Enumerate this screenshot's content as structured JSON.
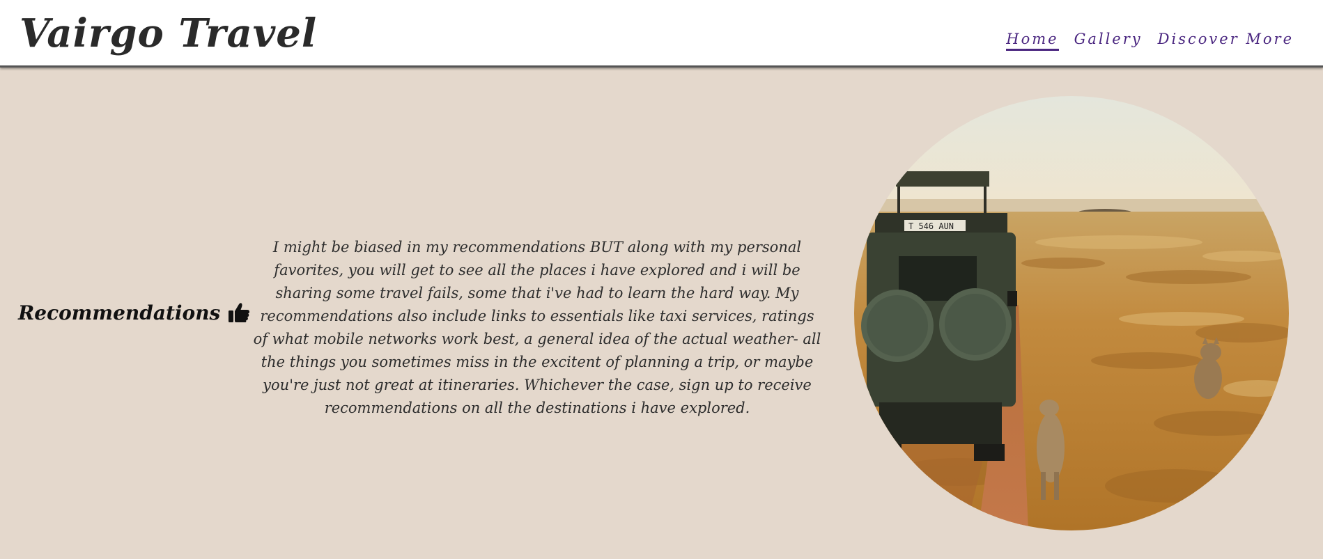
{
  "header": {
    "brand": "Vairgo Travel",
    "nav": [
      {
        "label": "Home",
        "active": true
      },
      {
        "label": "Gallery",
        "active": false
      },
      {
        "label": "Discover More",
        "active": false
      }
    ]
  },
  "main": {
    "section_title": "Recommendations",
    "section_icon": "thumbs-up-icon",
    "blurb_part1": "I might be biased in my recommendations BUT along with my personal favorites, you will get to see all the places i have explored and i will be sharing some travel fails, some that i've had to learn the hard way. My recommendations also include links to essentials like taxi services, ratings of what mobile networks work best, a general idea of the ",
    "blurb_emphasis": "actual",
    "blurb_part2": " weather- all the things you sometimes miss in the excitent of planning a trip, or maybe you're just not great at itineraries. Whichever the case, sign up to receive recommendations on all the destinations i have explored.",
    "photo": {
      "subject": "safari-jeep-lions-image",
      "plate": "T 546 AUN"
    }
  },
  "colors": {
    "page_bg": "#e4d8cc",
    "nav_accent": "#4a2680",
    "header_bg": "#ffffff"
  }
}
